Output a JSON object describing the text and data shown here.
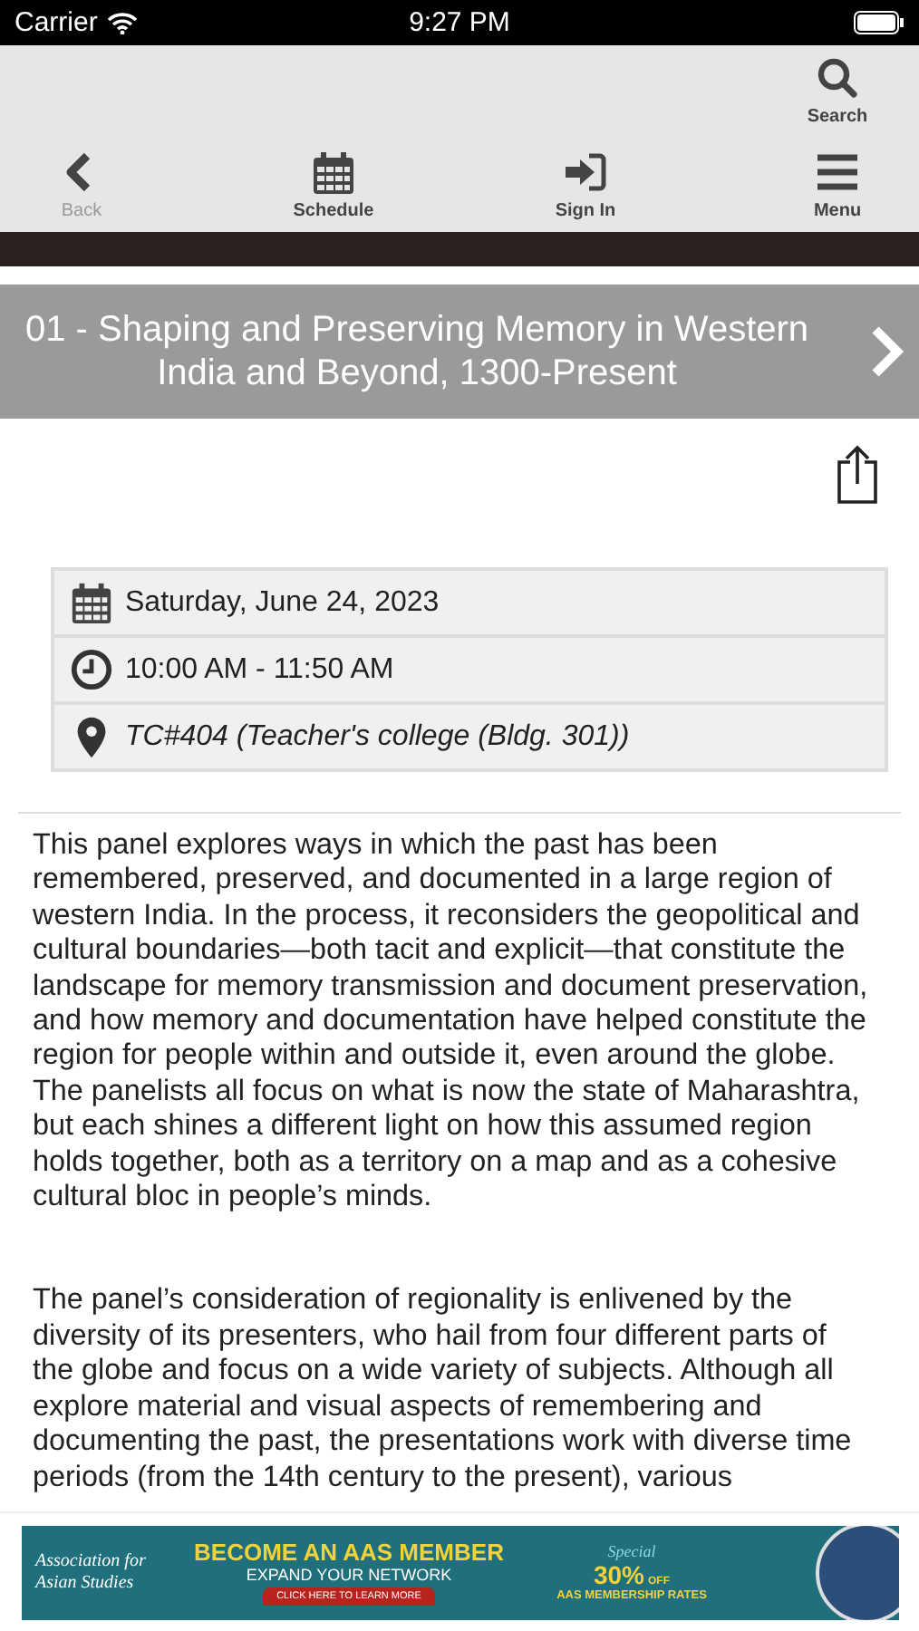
{
  "status_bar": {
    "carrier": "Carrier",
    "time": "9:27 PM"
  },
  "toolbar": {
    "search": {
      "label": "Search",
      "kind": "search"
    },
    "items": [
      {
        "label": "Back",
        "kind": "back",
        "disabled": true
      },
      {
        "label": "Schedule",
        "kind": "schedule",
        "disabled": false
      },
      {
        "label": "Sign In",
        "kind": "signin",
        "disabled": false
      },
      {
        "label": "Menu",
        "kind": "menu",
        "disabled": false
      }
    ]
  },
  "session": {
    "title": "01 - Shaping and Preserving Memory in Western India and Beyond, 1300-Present"
  },
  "details": [
    {
      "kind": "date",
      "text": "Saturday, June 24, 2023"
    },
    {
      "kind": "time",
      "text": "10:00 AM - 11:50 AM"
    },
    {
      "kind": "location",
      "text": "TC#404 (Teacher's college (Bldg. 301))"
    }
  ],
  "description": [
    "This panel explores ways in which the past has been remembered, preserved, and documented in a large region of western India. In the process, it reconsiders the geopolitical and cultural boundaries—both tacit and explicit—that constitute the landscape for memory transmission and document preservation, and how memory and documentation have helped constitute the region for people within and outside it, even around the globe. The panelists all focus on what is now the state of Maharashtra, but each shines a different light on how this assumed region holds together, both as a territory on a map and as a cohesive cultural bloc in people’s minds.",
    "The panel’s consideration of regionality is enlivened by the diversity of its presenters, who hail from four different parts of the globe and focus on a wide variety of subjects. Although all explore material and visual aspects of remembering and documenting the past, the presentations work with diverse time periods (from the 14th century to the present), various"
  ],
  "banner": {
    "org": "Association for Asian Studies",
    "headline": "BECOME AN AAS MEMBER",
    "subline": "EXPAND YOUR NETWORK",
    "cta": "CLICK HERE TO LEARN MORE",
    "special": "Special",
    "discount": "30%",
    "off": "OFF",
    "rates": "AAS MEMBERSHIP RATES"
  }
}
